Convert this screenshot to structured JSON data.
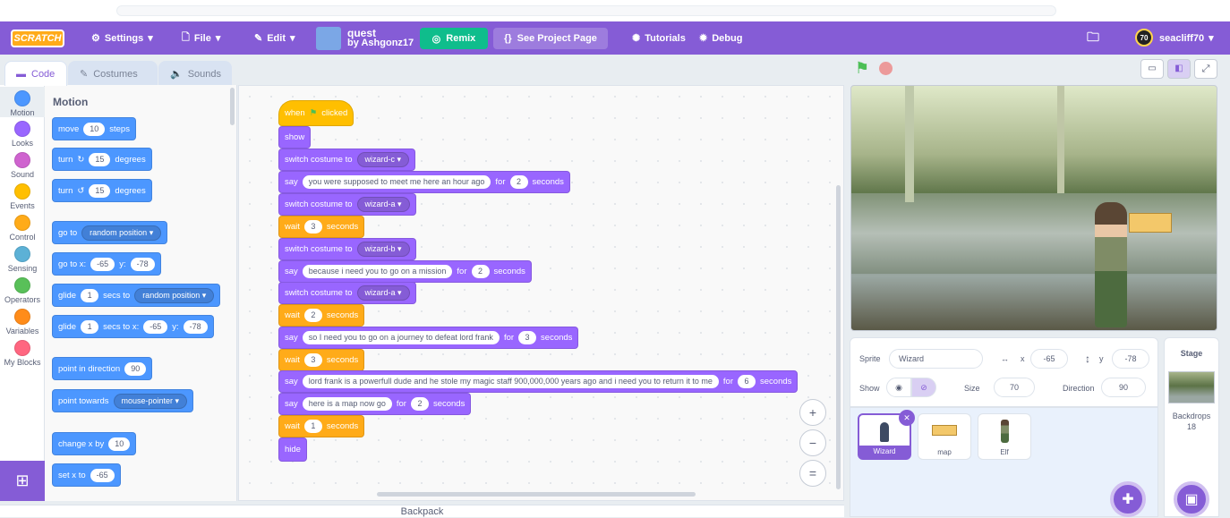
{
  "menubar": {
    "logo": "SCRATCH",
    "settings": "Settings",
    "file": "File",
    "edit": "Edit",
    "project_title": "quest",
    "project_author": "by Ashgonz17",
    "remix": "Remix",
    "see_project_page": "See Project Page",
    "tutorials": "Tutorials",
    "debug": "Debug",
    "username": "seacliff70",
    "avatar_text": "70"
  },
  "tabs": {
    "code": "Code",
    "costumes": "Costumes",
    "sounds": "Sounds"
  },
  "categories": [
    {
      "label": "Motion",
      "color": "#4c97ff"
    },
    {
      "label": "Looks",
      "color": "#9966ff"
    },
    {
      "label": "Sound",
      "color": "#cf63cf"
    },
    {
      "label": "Events",
      "color": "#ffbf00"
    },
    {
      "label": "Control",
      "color": "#ffab19"
    },
    {
      "label": "Sensing",
      "color": "#5cb1d6"
    },
    {
      "label": "Operators",
      "color": "#59c059"
    },
    {
      "label": "Variables",
      "color": "#ff8c1a"
    },
    {
      "label": "My Blocks",
      "color": "#ff6680"
    }
  ],
  "palette": {
    "title": "Motion",
    "move": {
      "a": "move",
      "v": "10",
      "b": "steps"
    },
    "turn_right": {
      "a": "turn",
      "v": "15",
      "b": "degrees"
    },
    "turn_left": {
      "a": "turn",
      "v": "15",
      "b": "degrees"
    },
    "goto": {
      "a": "go to",
      "dd": "random position"
    },
    "gotoxy": {
      "a": "go to x:",
      "x": "-65",
      "b": "y:",
      "y": "-78"
    },
    "glide_rand": {
      "a": "glide",
      "v": "1",
      "b": "secs to",
      "dd": "random position"
    },
    "glide_xy": {
      "a": "glide",
      "v": "1",
      "b": "secs to x:",
      "x": "-65",
      "c": "y:",
      "y": "-78"
    },
    "point_dir": {
      "a": "point in direction",
      "v": "90"
    },
    "point_towards": {
      "a": "point towards",
      "dd": "mouse-pointer"
    },
    "change_x": {
      "a": "change x by",
      "v": "10"
    },
    "set_x": {
      "a": "set x to",
      "v": "-65"
    }
  },
  "script": {
    "when_clicked": {
      "a": "when",
      "b": "clicked"
    },
    "show": "show",
    "switch_label": "switch costume to",
    "costume1": "wizard-c",
    "costume2": "wizard-a",
    "costume3": "wizard-b",
    "costume4": "wizard-a",
    "say_label": "say",
    "for_label": "for",
    "seconds_label": "seconds",
    "wait_label": "wait",
    "say1": {
      "text": "you were supposed to meet me here an hour ago",
      "secs": "2"
    },
    "wait1": "3",
    "say2": {
      "text": "because i need you to go on a mission",
      "secs": "2"
    },
    "wait2": "2",
    "say3": {
      "text": "so I need you to go on a journey to defeat lord frank",
      "secs": "3"
    },
    "wait3": "3",
    "say4": {
      "text": "lord frank is a powerfull dude and he stole my magic staff 900,000,000 years ago and i need you to return it to me",
      "secs": "6"
    },
    "say5": {
      "text": "here is a map now go",
      "secs": "2"
    },
    "wait4": "1",
    "hide": "hide"
  },
  "zoom": {
    "in": "+",
    "out": "−",
    "reset": "="
  },
  "backpack": "Backpack",
  "sprite_info": {
    "sprite_label": "Sprite",
    "sprite_name": "Wizard",
    "x_label": "x",
    "x": "-65",
    "y_label": "y",
    "y": "-78",
    "show_label": "Show",
    "size_label": "Size",
    "size": "70",
    "direction_label": "Direction",
    "direction": "90"
  },
  "sprites": [
    {
      "name": "Wizard",
      "selected": true
    },
    {
      "name": "map",
      "selected": false
    },
    {
      "name": "Elf",
      "selected": false
    }
  ],
  "stage_panel": {
    "title": "Stage",
    "backdrops_label": "Backdrops",
    "backdrops_count": "18"
  }
}
